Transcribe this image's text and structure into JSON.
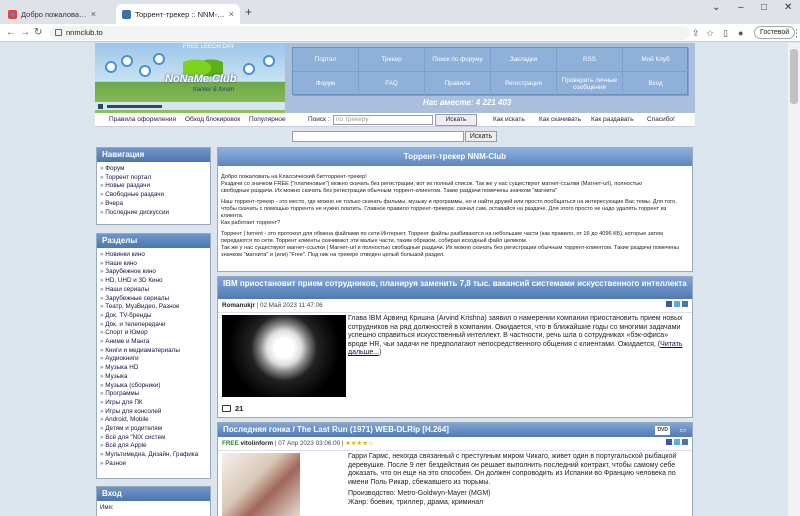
{
  "browser": {
    "tabs": [
      {
        "title": "Добро пожаловать в Chrome!"
      },
      {
        "title": "Торрент-трекер :: NNM-Club"
      }
    ],
    "url": "nnmclub.to",
    "profile": "Гостевой"
  },
  "header": {
    "free_leech": "FREE LEECH DAY",
    "logo_text": "NoNaMe Club",
    "logo_sub": "tracker & forum",
    "nav": [
      "Портал",
      "Трекер",
      "Поиск по форуму",
      "Закладки",
      "RSS",
      "Мой Клуб",
      "Форум",
      "FAQ",
      "Правила",
      "Регистрация",
      "Проверить личные сообщения",
      "Вход"
    ],
    "online": "Нас вместе: 4 221 403"
  },
  "subnav": {
    "links_left": [
      "Правила оформления",
      "Обход блокировок",
      "Популярное"
    ],
    "search_label": "Поиск :",
    "search_placeholder": "по трекеру",
    "search_button": "Искать",
    "links_right": [
      "Как искать",
      "Как скачивать",
      "Как раздавать",
      "Спасибо!"
    ]
  },
  "main_search_button": "Искать",
  "sidebar": {
    "nav_title": "Навигация",
    "nav_items": [
      "Форум",
      "Торрент портал",
      "Новые раздачи",
      "Свободные раздачи",
      "Вчера",
      "Последние дискуссии"
    ],
    "sections_title": "Разделы",
    "section_items": [
      "Новинки кино",
      "Наше кино",
      "Зарубежное кино",
      "HD, UHD и 3D Кино",
      "Наши сериалы",
      "Зарубежные сериалы",
      "Театр, МузВидео, Разное",
      "Док. TV-бренды",
      "Док. и телепередачи",
      "Спорт и Юмор",
      "Аниме и Манга",
      "Книги и медиаматериалы",
      "Аудиокниги",
      "Музыка HD",
      "Музыка",
      "Музыка (сборники)",
      "Программы",
      "Игры для ПК",
      "Игры для консолей",
      "Android, Mobile",
      "Детям и родителям",
      "Всё для \"NIX систем",
      "Всё для Apple",
      "Мультимедиа, Дизайн, Графика",
      "Разное"
    ],
    "login_title": "Вход",
    "login_label": "Имя:"
  },
  "main": {
    "title": "Торрент-трекер NNM-Club",
    "welcome": [
      "Добро пожаловать на Классический битторрент-трекер!",
      "Раздачи со значком FREE (\"платиновые\") можно скачать без регистрации, вот их полный список. Так же у нас существуют магнет-ссылки (Магнет-url), полностью",
      "свободные раздачи. Их можно скачать без регистрации обычным торрент-клиентом. Такие раздачи помечены значком \"магнита\"",
      "Наш торрент-трекер - это место, где можно не только скачать фильмы, музыку и программы, но и найти друзей или просто пообщаться на интересующие Вас темы. Для того, чтобы скачать с помощью торрента не нужно платить. Главное правило торрент-трекера: скачал сам, оставайся на раздаче. Для этого просто не надо удалять торрент из клиента.",
      "Как работает торрент?",
      "Торрент | torrent - это протокол для обмена файлами по сети Интернет. Торрент файлы разбиваются на небольшие части (как правило, от 16 до 4096 КБ), которые затем передаются по сети. Торрент клиенты скачивают эти малые части, таким образом, собирая исходный файл целиком.",
      "Так же у нас существуют магнет-ссылки | Магнет-url и полностью свободные раздачи. Их можно скачать без регистрации обычным торрент-клиентом. Такие раздачи помечены значком \"магнита\" и (или) \"Free\". Под ник на трекере отведен целый большой раздел."
    ],
    "news1": {
      "title": "IBM приостановит прием сотрудников, планируя заменить 7,8 тыс. вакансий системами искусственного интеллекта",
      "author": "Romanukjr",
      "date": "02 Май 2023 11:47:06",
      "body": "Глава IBM Арвинд Кришна (Arvind Krishna) заявил о намерении компании приостановить прием новых сотрудников на ряд должностей в компании. Ожидается, что в ближайшие годы со многими задачами успешно справиться искусственный интеллект. В частности, речь шла о сотрудниках «бэк-офиса» вроде HR, чьи задачи не предполагают непосредственного общения с клиентами. Ожидается, (",
      "more": "Читать дальше...",
      "more_close": ")",
      "comments": "21"
    },
    "news2": {
      "title": "Последняя гонка / The Last Run (1971) WEB-DLRip [H.264]",
      "free": "FREE",
      "author": "vitolinform",
      "date": "07 Апр 2023 03:06:00",
      "stars": "★★★★☆",
      "body": "Гарри Гармс, некогда связанный с преступным миром Чикаго, живет один в португальской рыбацкой деревушке. После 9 лет бездействия он решает выполнить последний контракт, чтобы самому себе доказать, что он еще на это способен. Он должен сопроводить из Испании во Францию человека по имени Поль Рикар, сбежавшего из тюрьмы.",
      "line2": "Производство: Metro-Goldwyn-Mayer (MGM)",
      "line3": "Жанр: боевик, триллер, драма, криминал"
    }
  }
}
